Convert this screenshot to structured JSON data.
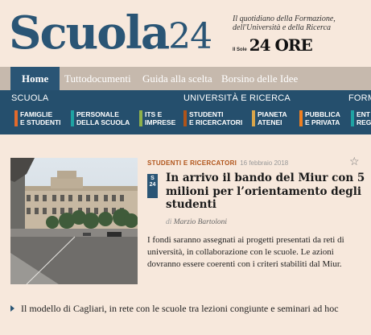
{
  "masthead": {
    "logo_word": "Scuola",
    "logo_number": "24",
    "tagline": "Il quotidiano della Formazione, dell'Università e della Ricerca",
    "publisher_small": "Il Sole",
    "publisher_big": "24 ORE"
  },
  "nav": {
    "items": [
      "Home",
      "Tuttodocumenti",
      "Guida alla scelta",
      "Borsino delle Idee"
    ]
  },
  "sections": {
    "groups": [
      "SCUOLA",
      "UNIVERSITÀ E RICERCA",
      "FORM"
    ],
    "subs": [
      {
        "line1": "FAMIGLIE",
        "line2": "E STUDENTI",
        "color": "#e36a2c"
      },
      {
        "line1": "PERSONALE",
        "line2": "DELLA SCUOLA",
        "color": "#1fa3a3"
      },
      {
        "line1": "ITS E",
        "line2": "IMPRESE",
        "color": "#8fb14a"
      },
      {
        "line1": "STUDENTI",
        "line2": "E RICERCATORI",
        "color": "#b0541a"
      },
      {
        "line1": "PIANETA",
        "line2": "ATENEI",
        "color": "#d8a54a"
      },
      {
        "line1": "PUBBLICA",
        "line2": "E PRIVATA",
        "color": "#f07f1f"
      },
      {
        "line1": "ENT",
        "line2": "REG",
        "color": "#1fa3a3"
      }
    ]
  },
  "article": {
    "category": "STUDENTI E RICERCATORI",
    "date": "16 febbraio 2018",
    "badge": "S24",
    "headline": "In arrivo il bando del Miur con 5 milioni per l’orientamento degli studenti",
    "byline_prefix": "di",
    "author": "Marzio Bartoloni",
    "summary": "I fondi saranno assegnati ai progetti presentati da reti di università, in collaborazione con le scuole. Le azioni dovranno essere coerenti con i criteri stabiliti dal Miur."
  },
  "related": {
    "text": "Il modello di Cagliari, in rete con le scuole tra lezioni congiunte e seminari ad hoc"
  },
  "colors": {
    "brand_blue": "#2a5575",
    "page_bg": "#f7e8dc",
    "category_orange": "#b0541a"
  }
}
